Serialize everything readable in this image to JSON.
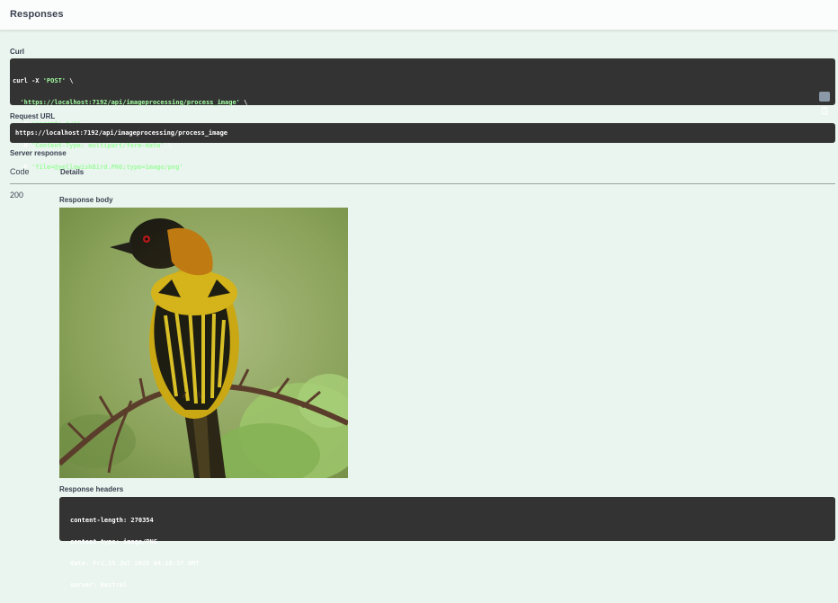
{
  "section": {
    "title": "Responses"
  },
  "curl": {
    "label": "Curl",
    "cmd_prefix": "curl -X ",
    "method": "'POST'",
    "url": "'https://localhost:7192/api/imageprocessing/process_image'",
    "accept_flag": "-H ",
    "accept": "'accept: */*'",
    "content_type_flag": "-H ",
    "content_type": "'Content-Type: multipart/form-data'",
    "file_flag": "-F ",
    "file": "'file=@yellowishBird.PNG;type=image/png'",
    "continuation": " \\",
    "copy_icon": "clipboard-icon"
  },
  "request_url": {
    "label": "Request URL",
    "value": "https://localhost:7192/api/imageprocessing/process_image"
  },
  "server_response": {
    "label": "Server response",
    "col_code": "Code",
    "col_details": "Details",
    "status_code": "200",
    "body_label": "Response body",
    "image_subject": "yellow-and-black weaver bird on branch",
    "headers_label": "Response headers",
    "headers": [
      "content-length: 270354",
      "content-type: image/PNG",
      "date: Fri,25 Jul 2025 04:16:37 GMT",
      "server: Kestrel"
    ]
  },
  "colors": {
    "background": "#e9f5ee",
    "code_bg": "#333333",
    "code_string": "#a2fca2",
    "text": "#3b4151"
  }
}
